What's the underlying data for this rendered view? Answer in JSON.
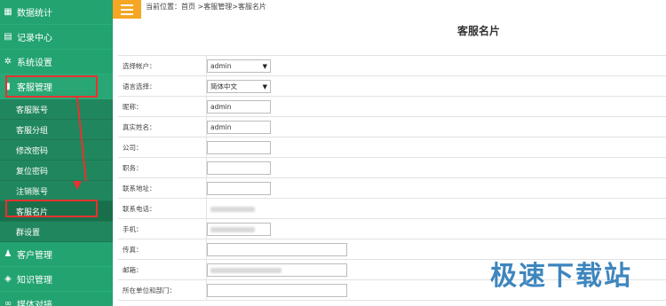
{
  "breadcrumb": "当前位置：首页 >客服管理>客服名片",
  "page_title": "客服名片",
  "sidebar": {
    "items": [
      {
        "label": "数据统计",
        "icon": "grid-icon"
      },
      {
        "label": "记录中心",
        "icon": "clipboard-icon"
      },
      {
        "label": "系统设置",
        "icon": "gear-icon"
      },
      {
        "label": "客服管理",
        "icon": "user-icon"
      },
      {
        "label": "客户管理",
        "icon": "users-icon"
      },
      {
        "label": "知识管理",
        "icon": "layers-icon"
      },
      {
        "label": "媒体对接",
        "icon": "link-icon"
      }
    ],
    "subitems": [
      {
        "label": "客服账号"
      },
      {
        "label": "客服分组"
      },
      {
        "label": "修改密码"
      },
      {
        "label": "复位密码"
      },
      {
        "label": "注销账号"
      },
      {
        "label": "客服名片"
      },
      {
        "label": "群设置"
      }
    ]
  },
  "form": {
    "rows": [
      {
        "label": "选择帐户：",
        "value": "admin"
      },
      {
        "label": "语言选择：",
        "value": "简体中文"
      },
      {
        "label": "昵称：",
        "value": "admin"
      },
      {
        "label": "真实姓名：",
        "value": "admin"
      },
      {
        "label": "公司：",
        "value": ""
      },
      {
        "label": "职务：",
        "value": ""
      },
      {
        "label": "联系地址：",
        "value": ""
      },
      {
        "label": "联系电话：",
        "value": ""
      },
      {
        "label": "手机：",
        "value": ""
      },
      {
        "label": "传真：",
        "value": ""
      },
      {
        "label": "邮箱：",
        "value": ""
      },
      {
        "label": "所在单位和部门：",
        "value": ""
      }
    ]
  },
  "watermark": "极速下载站"
}
